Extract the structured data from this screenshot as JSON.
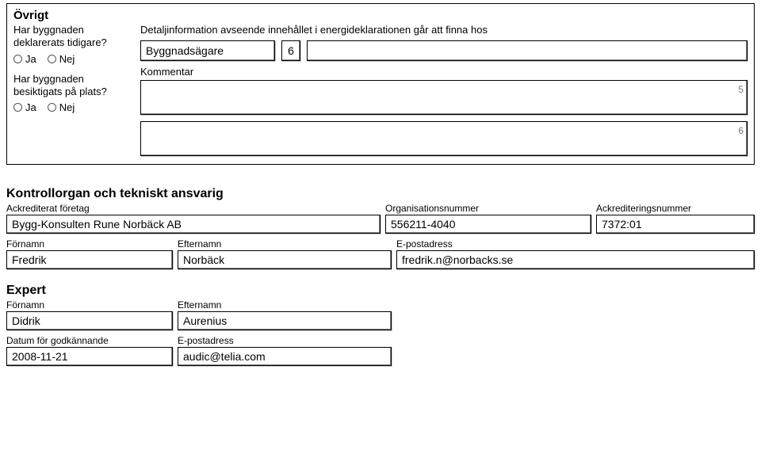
{
  "ovrigt": {
    "title": "Övrigt",
    "q1": "Har byggnaden deklarerats tidigare?",
    "q2": "Har byggnaden besiktigats på plats?",
    "ja": "Ja",
    "nej": "Nej",
    "detail_text": "Detaljinformation avseende innehållet i energideklarationen går att finna hos",
    "source_name": "Byggnadsägare",
    "source_num": "6",
    "kommentar_label": "Kommentar",
    "side1": "5",
    "side2": "6"
  },
  "kontroll": {
    "heading": "Kontrollorgan och tekniskt ansvarig",
    "labels": {
      "company": "Ackrediterat företag",
      "org": "Organisationsnummer",
      "accnum": "Ackrediteringsnummer",
      "fname": "Förnamn",
      "lname": "Efternamn",
      "email": "E-postadress"
    },
    "company": "Bygg-Konsulten Rune Norbäck AB",
    "org": "556211-4040",
    "accnum": "7372:01",
    "fname": "Fredrik",
    "lname": "Norbäck",
    "email": "fredrik.n@norbacks.se"
  },
  "expert": {
    "heading": "Expert",
    "labels": {
      "fname": "Förnamn",
      "lname": "Efternamn",
      "date": "Datum för godkännande",
      "email": "E-postadress"
    },
    "fname": "Didrik",
    "lname": "Aurenius",
    "date": "2008-11-21",
    "email": "audic@telia.com"
  }
}
